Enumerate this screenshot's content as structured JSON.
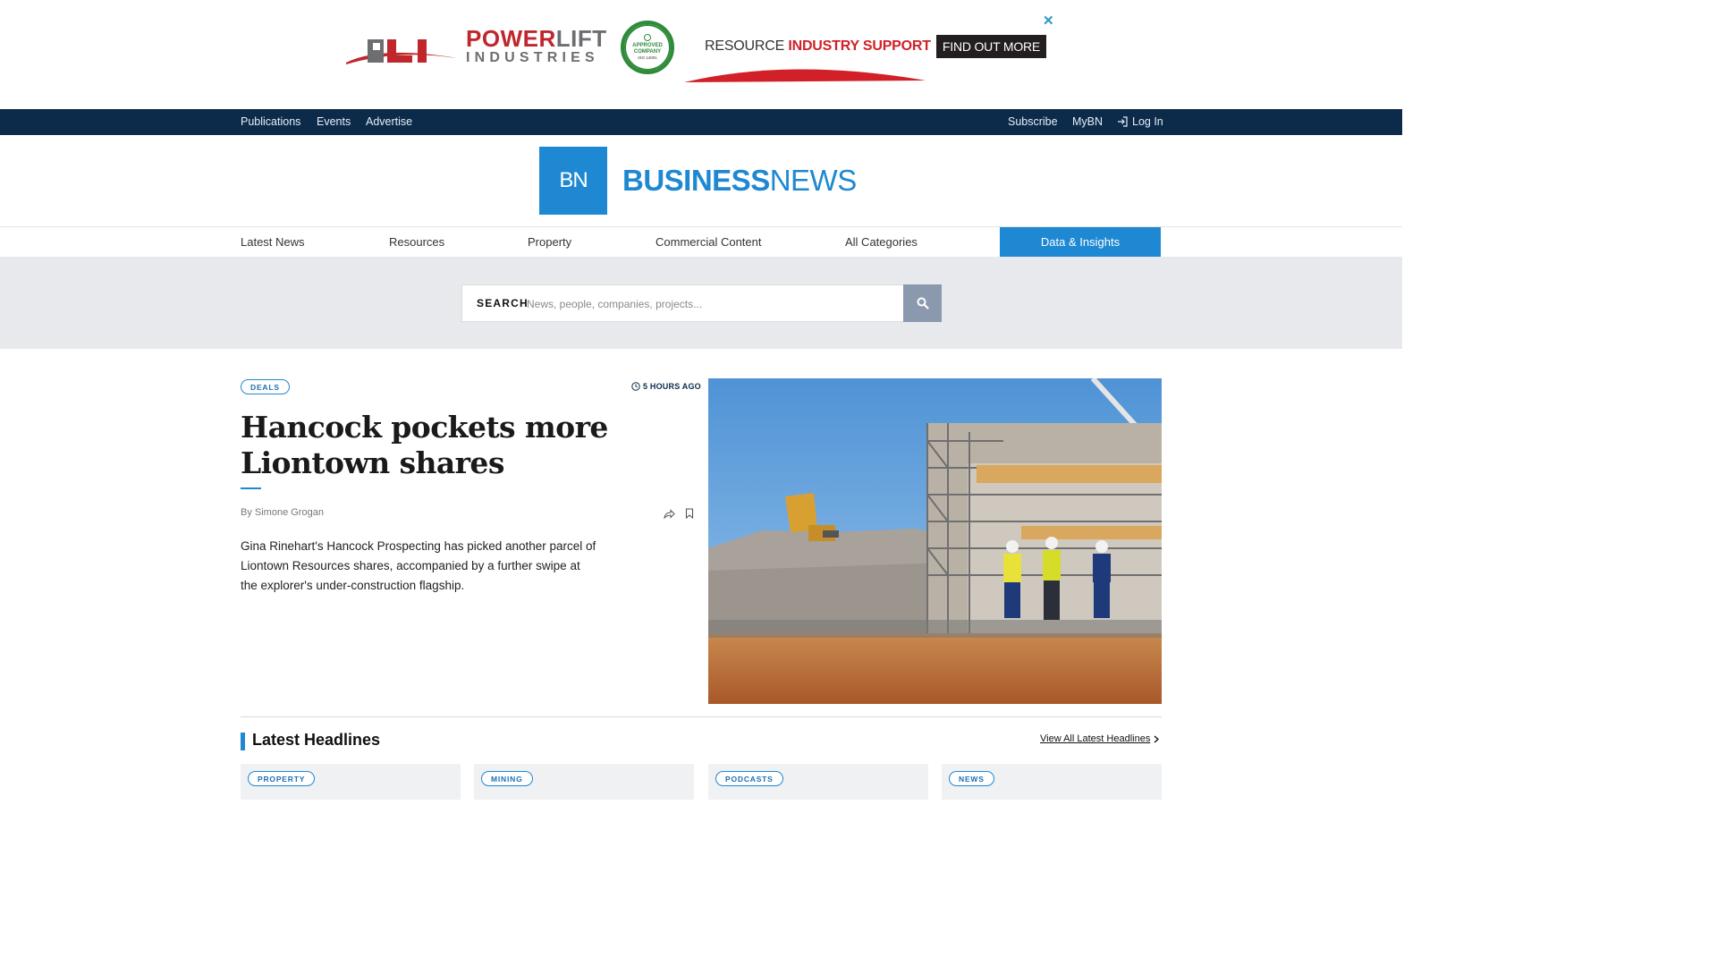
{
  "ad": {
    "brand_top_red": "POWER",
    "brand_top_grey": "LIFT",
    "brand_bottom": "INDUSTRIES",
    "badge_title": "APPROVED COMPANY",
    "badge_code": "ISO 14001",
    "tagline_plain": "RESOURCE",
    "tagline_bold": "INDUSTRY SUPPORT",
    "cta": "FIND OUT MORE",
    "close": "✕",
    "colors": {
      "red": "#c0272d",
      "grey": "#6d6e71",
      "green": "#2f8a3a"
    }
  },
  "topnav": {
    "publications": "Publications",
    "events": "Events",
    "advertise": "Advertise",
    "subscribe": "Subscribe",
    "mybn": "MyBN",
    "login": "Log In"
  },
  "logo": {
    "mark": "BN",
    "word_bold": "BUSINESS",
    "word_light": "NEWS",
    "color": "#1e88d2"
  },
  "mainnav": {
    "latest_news": "Latest News",
    "resources": "Resources",
    "property": "Property",
    "commercial": "Commercial Content",
    "all_categories": "All Categories",
    "data_insights": "Data & Insights"
  },
  "search": {
    "label": "SEARCH",
    "placeholder": "News, people, companies, projects...",
    "value": ""
  },
  "feature": {
    "tag": "DEALS",
    "time": "5 HOURS AGO",
    "headline": "Hancock pockets more Liontown shares",
    "byline": "By Simone Grogan",
    "summary": "Gina Rinehart's Hancock Prospecting has picked another parcel of Liontown Resources shares, accompanied by a further swipe at the explorer's under-construction flagship."
  },
  "latest": {
    "title": "Latest Headlines",
    "view_all": "View All Latest Headlines",
    "cards": [
      {
        "tag": "PROPERTY"
      },
      {
        "tag": "MINING"
      },
      {
        "tag": "PODCASTS"
      },
      {
        "tag": "NEWS"
      }
    ]
  }
}
